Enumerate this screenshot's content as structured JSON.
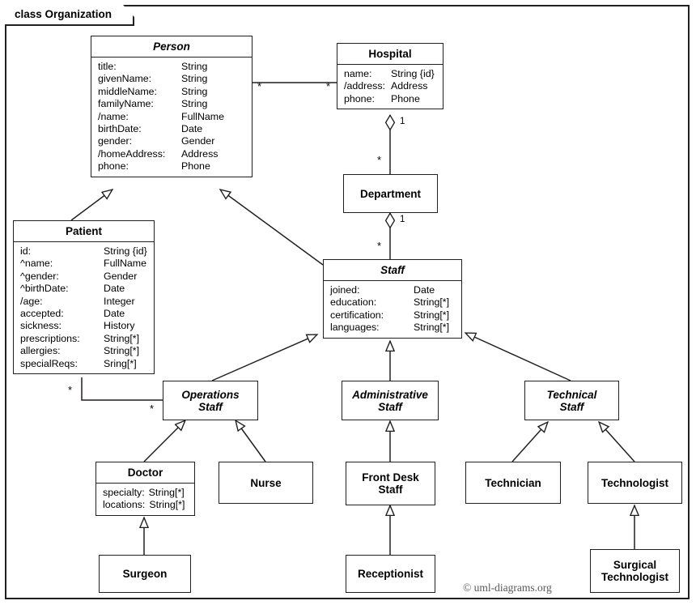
{
  "diagram": {
    "frame_label": "class Organization",
    "watermark": "© uml-diagrams.org",
    "stroke_color": "#231f20",
    "background_color": "#ffffff"
  },
  "classes": {
    "person": {
      "name": "Person",
      "abstract": true,
      "attributes": [
        {
          "name": "title:",
          "type": "String"
        },
        {
          "name": "givenName:",
          "type": "String"
        },
        {
          "name": "middleName:",
          "type": "String"
        },
        {
          "name": "familyName:",
          "type": "String"
        },
        {
          "name": "/name:",
          "type": "FullName"
        },
        {
          "name": "birthDate:",
          "type": "Date"
        },
        {
          "name": "gender:",
          "type": "Gender"
        },
        {
          "name": "/homeAddress:",
          "type": "Address"
        },
        {
          "name": "phone:",
          "type": "Phone"
        }
      ]
    },
    "hospital": {
      "name": "Hospital",
      "abstract": false,
      "attributes": [
        {
          "name": "name:",
          "type": "String {id}"
        },
        {
          "name": "/address:",
          "type": "Address"
        },
        {
          "name": "phone:",
          "type": "Phone"
        }
      ]
    },
    "patient": {
      "name": "Patient",
      "abstract": false,
      "attributes": [
        {
          "name": "id:",
          "type": "String {id}"
        },
        {
          "name": "^name:",
          "type": "FullName"
        },
        {
          "name": "^gender:",
          "type": "Gender"
        },
        {
          "name": "^birthDate:",
          "type": "Date"
        },
        {
          "name": "/age:",
          "type": "Integer"
        },
        {
          "name": "accepted:",
          "type": "Date"
        },
        {
          "name": "sickness:",
          "type": "History"
        },
        {
          "name": "prescriptions:",
          "type": "String[*]"
        },
        {
          "name": "allergies:",
          "type": "String[*]"
        },
        {
          "name": "specialReqs:",
          "type": "Sring[*]"
        }
      ]
    },
    "department": {
      "name": "Department",
      "abstract": false,
      "attributes": []
    },
    "staff": {
      "name": "Staff",
      "abstract": true,
      "attributes": [
        {
          "name": "joined:",
          "type": "Date"
        },
        {
          "name": "education:",
          "type": "String[*]"
        },
        {
          "name": "certification:",
          "type": "String[*]"
        },
        {
          "name": "languages:",
          "type": "String[*]"
        }
      ]
    },
    "operations_staff": {
      "name": "Operations\nStaff",
      "abstract": true,
      "attributes": []
    },
    "administrative_staff": {
      "name": "Administrative\nStaff",
      "abstract": true,
      "attributes": []
    },
    "technical_staff": {
      "name": "Technical\nStaff",
      "abstract": true,
      "attributes": []
    },
    "doctor": {
      "name": "Doctor",
      "abstract": false,
      "attributes": [
        {
          "name": "specialty:",
          "type": "String[*]"
        },
        {
          "name": "locations:",
          "type": "String[*]"
        }
      ]
    },
    "nurse": {
      "name": "Nurse",
      "abstract": false,
      "attributes": []
    },
    "front_desk_staff": {
      "name": "Front Desk\nStaff",
      "abstract": false,
      "attributes": []
    },
    "technician": {
      "name": "Technician",
      "abstract": false,
      "attributes": []
    },
    "technologist": {
      "name": "Technologist",
      "abstract": false,
      "attributes": []
    },
    "surgeon": {
      "name": "Surgeon",
      "abstract": false,
      "attributes": []
    },
    "receptionist": {
      "name": "Receptionist",
      "abstract": false,
      "attributes": []
    },
    "surgical_technologist": {
      "name": "Surgical\nTechnologist",
      "abstract": false,
      "attributes": []
    }
  },
  "multiplicities": {
    "person_hospital_person_end": "*",
    "person_hospital_hospital_end": "*",
    "hospital_department_hospital_end": "1",
    "hospital_department_department_end": "*",
    "department_staff_department_end": "1",
    "department_staff_staff_end": "*",
    "patient_operations_patient_end": "*",
    "patient_operations_operations_end": "*"
  },
  "relationships": [
    {
      "type": "association",
      "from": "Person",
      "to": "Hospital"
    },
    {
      "type": "aggregation",
      "from": "Hospital",
      "to": "Department"
    },
    {
      "type": "aggregation",
      "from": "Department",
      "to": "Staff"
    },
    {
      "type": "association",
      "from": "Patient",
      "to": "Operations Staff"
    },
    {
      "type": "generalization",
      "from": "Patient",
      "to": "Person"
    },
    {
      "type": "generalization",
      "from": "Staff",
      "to": "Person"
    },
    {
      "type": "generalization",
      "from": "Operations Staff",
      "to": "Staff"
    },
    {
      "type": "generalization",
      "from": "Administrative Staff",
      "to": "Staff"
    },
    {
      "type": "generalization",
      "from": "Technical Staff",
      "to": "Staff"
    },
    {
      "type": "generalization",
      "from": "Doctor",
      "to": "Operations Staff"
    },
    {
      "type": "generalization",
      "from": "Nurse",
      "to": "Operations Staff"
    },
    {
      "type": "generalization",
      "from": "Front Desk Staff",
      "to": "Administrative Staff"
    },
    {
      "type": "generalization",
      "from": "Technician",
      "to": "Technical Staff"
    },
    {
      "type": "generalization",
      "from": "Technologist",
      "to": "Technical Staff"
    },
    {
      "type": "generalization",
      "from": "Surgeon",
      "to": "Doctor"
    },
    {
      "type": "generalization",
      "from": "Receptionist",
      "to": "Front Desk Staff"
    },
    {
      "type": "generalization",
      "from": "Surgical Technologist",
      "to": "Technologist"
    }
  ]
}
